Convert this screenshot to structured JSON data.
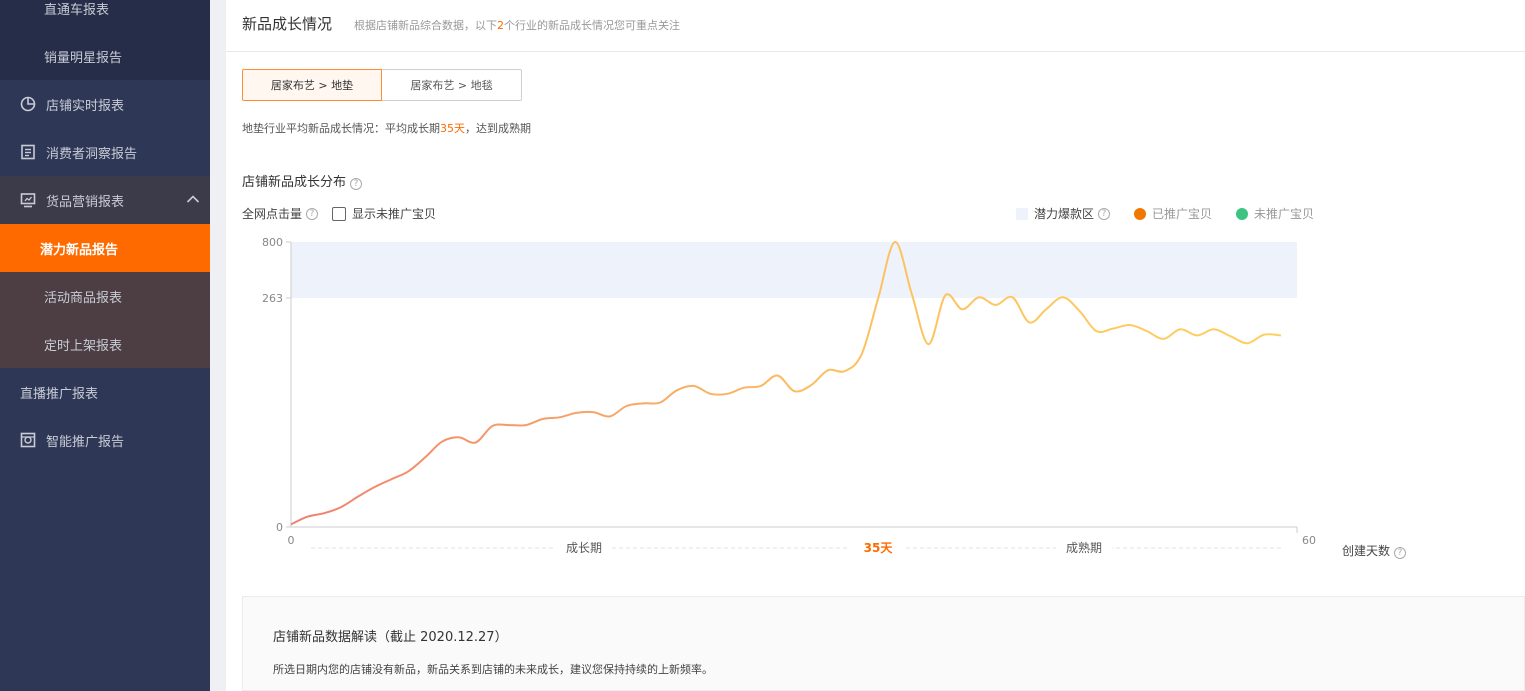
{
  "sidebar": {
    "items": [
      {
        "label": "直通车报表",
        "icon": ""
      },
      {
        "label": "销量明星报告",
        "icon": ""
      },
      {
        "label": "店铺实时报表",
        "icon": "pie-chart-icon"
      },
      {
        "label": "消费者洞察报告",
        "icon": "document-icon"
      },
      {
        "label": "货品营销报表",
        "icon": "monitor-icon"
      },
      {
        "label": "潜力新品报告",
        "icon": ""
      },
      {
        "label": "活动商品报表",
        "icon": ""
      },
      {
        "label": "定时上架报表",
        "icon": ""
      },
      {
        "label": "直播推广报表",
        "icon": ""
      },
      {
        "label": "智能推广报告",
        "icon": "target-icon"
      }
    ]
  },
  "header": {
    "title": "新品成长情况",
    "desc_prefix": "根据店铺新品综合数据，以下",
    "desc_count": "2",
    "desc_suffix": "个行业的新品成长情况您可重点关注"
  },
  "tabs": [
    "居家布艺 > 地垫",
    "居家布艺 > 地毯"
  ],
  "summary": {
    "prefix": "地垫行业平均新品成长情况：平均成长期",
    "days": "35天",
    "suffix": "，达到成熟期"
  },
  "section": {
    "title": "店铺新品成长分布",
    "y_label": "全网点击量",
    "checkbox_label": "显示未推广宝贝"
  },
  "legend": {
    "zone": "潜力爆款区",
    "promoted": "已推广宝贝",
    "unpromoted": "未推广宝贝"
  },
  "colors": {
    "accent": "#ff6a00",
    "sidebar_bg": "#2e3756",
    "zone": "#eef3fb",
    "promoted": "#f07800",
    "unpromoted": "#3cc480",
    "line_start": "#f08070",
    "line_end": "#fdd060"
  },
  "chart_data": {
    "type": "line",
    "xlabel": "创建天数",
    "x_ticks": [
      "0",
      "60"
    ],
    "y_ticks": [
      "0",
      "263",
      "800"
    ],
    "phase_labels": [
      "成长期",
      "35天",
      "成熟期"
    ],
    "xlim": [
      0,
      60
    ],
    "y_breakpoints": [
      0,
      263,
      800
    ],
    "zone": {
      "from": 263,
      "to": 800
    },
    "x": [
      0,
      1,
      2,
      3,
      4,
      5,
      6,
      7,
      8,
      9,
      10,
      11,
      12,
      13,
      14,
      15,
      16,
      17,
      18,
      19,
      20,
      21,
      22,
      23,
      24,
      25,
      26,
      27,
      28,
      29,
      30,
      31,
      32,
      33,
      34,
      35,
      36,
      37,
      38,
      39,
      40,
      41,
      42,
      43,
      44,
      45,
      46,
      47,
      48,
      49,
      50,
      51,
      52,
      53,
      54,
      55,
      56,
      57,
      58,
      59
    ],
    "values": [
      3,
      12,
      16,
      23,
      35,
      46,
      55,
      64,
      80,
      98,
      103,
      97,
      116,
      117,
      117,
      124,
      126,
      131,
      132,
      127,
      139,
      142,
      143,
      157,
      162,
      153,
      153,
      160,
      162,
      174,
      156,
      163,
      180,
      179,
      198,
      265,
      800,
      300,
      210,
      290,
      250,
      270,
      255,
      270,
      235,
      250,
      270,
      248,
      225,
      228,
      232,
      225,
      216,
      227,
      220,
      227,
      219,
      211,
      221,
      220
    ]
  },
  "panel": {
    "title": "店铺新品数据解读（截止 2020.12.27）",
    "text": "所选日期内您的店铺没有新品，新品关系到店铺的未来成长，建议您保持持续的上新频率。"
  }
}
